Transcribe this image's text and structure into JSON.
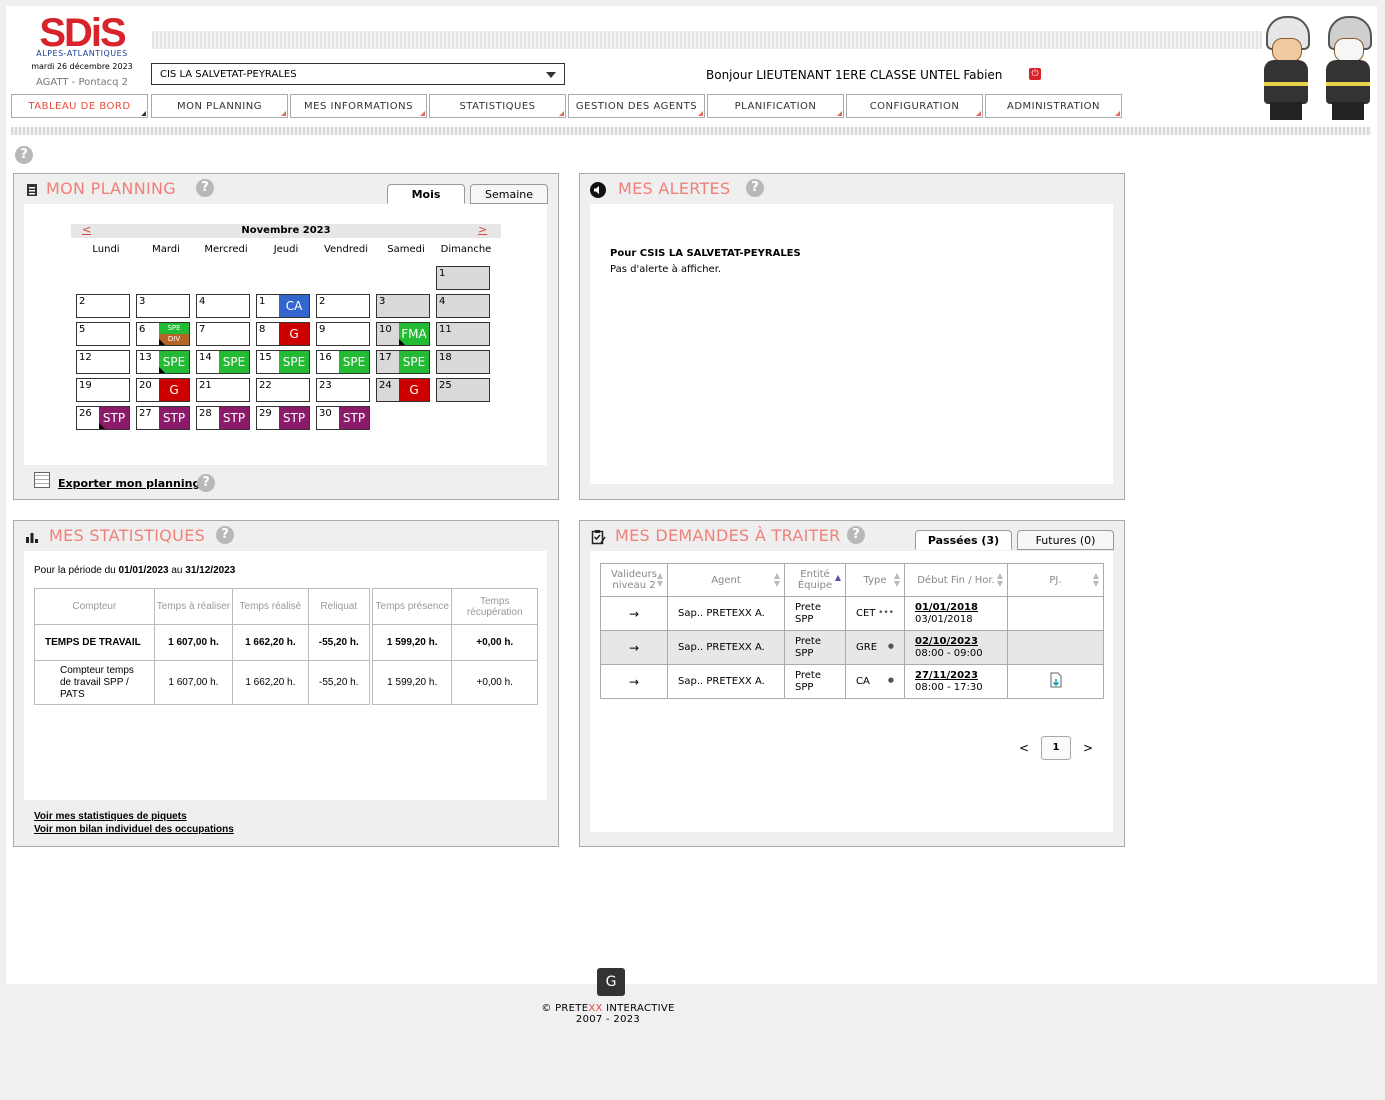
{
  "header": {
    "logo_text": "SDiS",
    "logo_sub": "ALPES-ATLANTIQUES",
    "date": "mardi 26 décembre 2023",
    "app": "AGATT - Pontacq 2",
    "centre": "CIS LA SALVETAT-PEYRALES",
    "hello": "Bonjour LIEUTENANT 1ERE CLASSE UNTEL Fabien"
  },
  "nav": [
    {
      "label": "TABLEAU DE BORD"
    },
    {
      "label": "MON PLANNING"
    },
    {
      "label": "MES INFORMATIONS"
    },
    {
      "label": "STATISTIQUES"
    },
    {
      "label": "GESTION DES AGENTS"
    },
    {
      "label": "PLANIFICATION"
    },
    {
      "label": "CONFIGURATION"
    },
    {
      "label": "ADMINISTRATION"
    }
  ],
  "help_glyph": "?",
  "planning": {
    "title": "MON PLANNING",
    "tab_month": "Mois",
    "tab_week": "Semaine",
    "month": "Novembre 2023",
    "prev": "<",
    "next": ">",
    "days": [
      "Lundi",
      "Mardi",
      "Mercredi",
      "Jeudi",
      "Vendredi",
      "Samedi",
      "Dimanche"
    ],
    "export": "Exporter mon planning"
  },
  "alerts": {
    "title": "MES ALERTES",
    "line1": "Pour CSIS LA SALVETAT-PEYRALES",
    "line2": "Pas d'alerte à afficher."
  },
  "stats": {
    "title": "MES STATISTIQUES",
    "period_prefix": "Pour la période du ",
    "period_from": "01/01/2023",
    "period_mid": " au ",
    "period_to": "31/12/2023",
    "headers": [
      "Compteur",
      "Temps à réaliser",
      "Temps réalisé",
      "Reliquat",
      "Temps présence",
      "Temps récupération"
    ],
    "rows": [
      [
        "TEMPS DE TRAVAIL",
        "1 607,00 h.",
        "1 662,20 h.",
        "-55,20 h.",
        "1 599,20 h.",
        "+0,00 h."
      ],
      [
        "Compteur temps de travail SPP / PATS",
        "1 607,00 h.",
        "1 662,20 h.",
        "-55,20 h.",
        "1 599,20 h.",
        "+0,00 h."
      ]
    ],
    "link1": "Voir mes statistiques de piquets",
    "link2": "Voir mon bilan individuel des occupations"
  },
  "demandes": {
    "title": "MES DEMANDES À TRAITER",
    "tab_past": "Passées (3)",
    "tab_future": "Futures (0)",
    "headers": [
      "Valideurs niveau 2",
      "Agent",
      "Entité Équipe",
      "Type",
      "Début Fin / Hor.",
      "PJ."
    ],
    "rows": [
      {
        "arrow": "→",
        "agent": "Sap.. PRETEXX A.",
        "entite": "Prete",
        "equipe": "SPP",
        "type": "CET",
        "dots": "•••",
        "debut": "01/01/2018",
        "fin": "03/01/2018"
      },
      {
        "arrow": "→",
        "agent": "Sap.. PRETEXX A.",
        "entite": "Prete",
        "equipe": "SPP",
        "type": "GRE",
        "dots": "●",
        "debut": "02/10/2023",
        "fin": "08:00 - 09:00"
      },
      {
        "arrow": "→",
        "agent": "Sap.. PRETEXX A.",
        "entite": "Prete",
        "equipe": "SPP",
        "type": "CA",
        "dots": "●",
        "debut": "27/11/2023",
        "fin": "08:00 - 17:30"
      }
    ],
    "pager_prev": "<",
    "pager_page": "1",
    "pager_next": ">"
  },
  "footer": {
    "logo": "G",
    "brand_a": "© PRETE",
    "brand_b": "XX",
    "brand_c": " INTERACTIVE",
    "years": "2007 - 2023"
  },
  "calendar_cells": [
    {
      "d": "1",
      "row": 0,
      "col": 6,
      "wk": true
    },
    {
      "d": "2",
      "row": 1,
      "col": 0
    },
    {
      "d": "3",
      "row": 1,
      "col": 1
    },
    {
      "d": "4",
      "row": 1,
      "col": 2
    },
    {
      "d": "1",
      "row": 1,
      "col": 3,
      "ev": "CA",
      "color": "#3366cc"
    },
    {
      "d": "2",
      "row": 1,
      "col": 4
    },
    {
      "d": "3",
      "row": 1,
      "col": 5,
      "wk": true
    },
    {
      "d": "4",
      "row": 1,
      "col": 6,
      "wk": true
    },
    {
      "d": "5",
      "row": 2,
      "col": 0
    },
    {
      "d": "6",
      "row": 2,
      "col": 1,
      "ev1": "SPE",
      "c1": "#22bb33",
      "ev2": "DIV",
      "c2": "#b5652a"
    },
    {
      "d": "7",
      "row": 2,
      "col": 2
    },
    {
      "d": "8",
      "row": 2,
      "col": 3,
      "ev": "G",
      "color": "#cc0000"
    },
    {
      "d": "9",
      "row": 2,
      "col": 4
    },
    {
      "d": "10",
      "row": 2,
      "col": 5,
      "wk": true,
      "ev": "FMA",
      "color": "#22bb33",
      "tri": true
    },
    {
      "d": "11",
      "row": 2,
      "col": 6,
      "wk": true
    },
    {
      "d": "12",
      "row": 3,
      "col": 0
    },
    {
      "d": "13",
      "row": 3,
      "col": 1,
      "ev": "SPE",
      "color": "#22bb33",
      "tri": true
    },
    {
      "d": "14",
      "row": 3,
      "col": 2,
      "ev": "SPE",
      "color": "#22bb33"
    },
    {
      "d": "15",
      "row": 3,
      "col": 3,
      "ev": "SPE",
      "color": "#22bb33"
    },
    {
      "d": "16",
      "row": 3,
      "col": 4,
      "ev": "SPE",
      "color": "#22bb33"
    },
    {
      "d": "17",
      "row": 3,
      "col": 5,
      "wk": true,
      "ev": "SPE",
      "color": "#22bb33"
    },
    {
      "d": "18",
      "row": 3,
      "col": 6,
      "wk": true
    },
    {
      "d": "19",
      "row": 4,
      "col": 0
    },
    {
      "d": "20",
      "row": 4,
      "col": 1,
      "ev": "G",
      "color": "#cc0000"
    },
    {
      "d": "21",
      "row": 4,
      "col": 2
    },
    {
      "d": "22",
      "row": 4,
      "col": 3
    },
    {
      "d": "23",
      "row": 4,
      "col": 4
    },
    {
      "d": "24",
      "row": 4,
      "col": 5,
      "wk": true,
      "ev": "G",
      "color": "#cc0000"
    },
    {
      "d": "25",
      "row": 4,
      "col": 6,
      "wk": true
    },
    {
      "d": "26",
      "row": 5,
      "col": 0,
      "ev": "STP",
      "color": "#8b1a6b",
      "tri": true
    },
    {
      "d": "27",
      "row": 5,
      "col": 1,
      "ev": "STP",
      "color": "#8b1a6b"
    },
    {
      "d": "28",
      "row": 5,
      "col": 2,
      "ev": "STP",
      "color": "#8b1a6b"
    },
    {
      "d": "29",
      "row": 5,
      "col": 3,
      "ev": "STP",
      "color": "#8b1a6b"
    },
    {
      "d": "30",
      "row": 5,
      "col": 4,
      "ev": "STP",
      "color": "#8b1a6b"
    }
  ]
}
